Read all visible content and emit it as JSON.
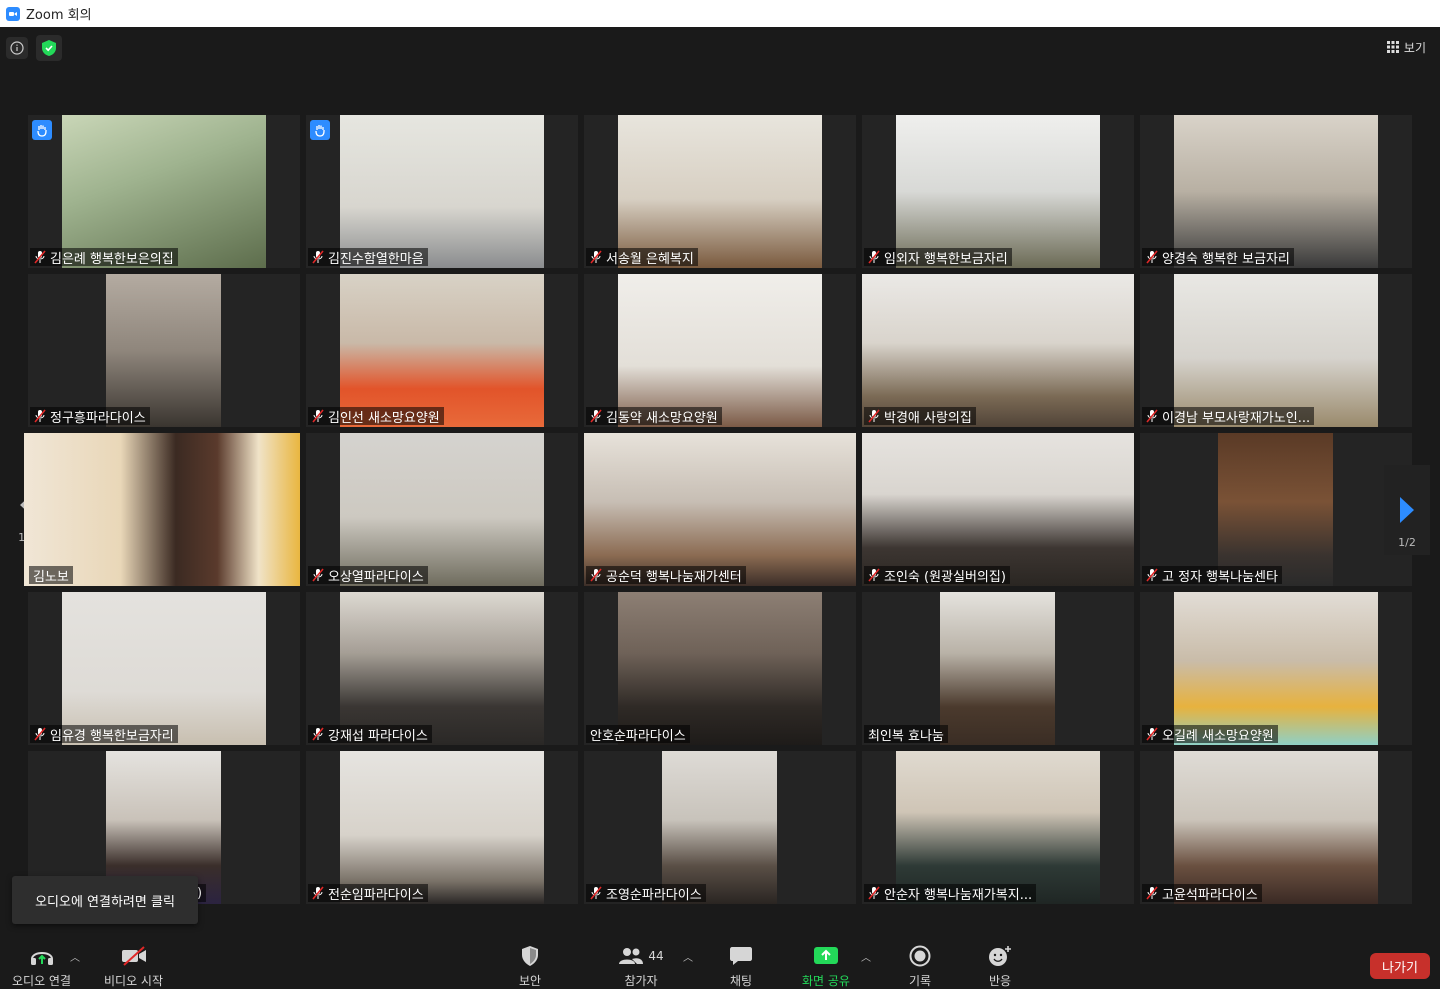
{
  "window": {
    "title": "Zoom 회의"
  },
  "topbar": {
    "view_label": "보기"
  },
  "pager": {
    "left_page": "1/2",
    "right_page": "1/2"
  },
  "tooltip": {
    "text": "오디오에 연결하려면 클릭"
  },
  "participants": [
    {
      "name": "김은례 행복한보은의집",
      "muted": true,
      "hand": true
    },
    {
      "name": "김진수함열한마음",
      "muted": true,
      "hand": true
    },
    {
      "name": "서송월 은혜복지",
      "muted": true,
      "hand": false
    },
    {
      "name": "임외자 행복한보금자리",
      "muted": true,
      "hand": false
    },
    {
      "name": "양경숙 행복한 보금자리",
      "muted": true,
      "hand": false
    },
    {
      "name": "정구흥파라다이스",
      "muted": true,
      "hand": false
    },
    {
      "name": "김인선 새소망요양원",
      "muted": true,
      "hand": false
    },
    {
      "name": "김동약 새소망요양원",
      "muted": true,
      "hand": false
    },
    {
      "name": "박경애 사랑의집",
      "muted": true,
      "hand": false
    },
    {
      "name": "이경남 부모사랑재가노인...",
      "muted": true,
      "hand": false
    },
    {
      "name": "김노보",
      "muted": false,
      "hand": false,
      "active": true
    },
    {
      "name": "오상열파라다이스",
      "muted": true,
      "hand": false
    },
    {
      "name": "공순덕 행복나눔재가센터",
      "muted": true,
      "hand": false
    },
    {
      "name": "조인숙 (원광실버의집)",
      "muted": true,
      "hand": false
    },
    {
      "name": "고 정자 행복나눔센타",
      "muted": true,
      "hand": false
    },
    {
      "name": "임유경 행복한보금자리",
      "muted": true,
      "hand": false
    },
    {
      "name": "강재섭 파라다이스",
      "muted": true,
      "hand": false
    },
    {
      "name": "안호순파라다이스",
      "muted": false,
      "hand": false
    },
    {
      "name": "최인복 효나눔",
      "muted": false,
      "hand": false
    },
    {
      "name": "오길례 새소망요양원",
      "muted": true,
      "hand": false
    },
    {
      "name": ")",
      "muted": false,
      "hand": false
    },
    {
      "name": "전순임파라다이스",
      "muted": true,
      "hand": false
    },
    {
      "name": "조영순파라다이스",
      "muted": true,
      "hand": false
    },
    {
      "name": "안순자 행복나눔재가복지...",
      "muted": true,
      "hand": false
    },
    {
      "name": "고윤석파라다이스",
      "muted": true,
      "hand": false
    }
  ],
  "toolbar": {
    "audio": "오디오 연결",
    "video": "비디오 시작",
    "security": "보안",
    "participants": "참가자",
    "participants_count": "44",
    "chat": "채팅",
    "share": "화면 공유",
    "record": "기록",
    "reactions": "반응",
    "leave": "나가기"
  },
  "colors": {
    "accent_blue": "#2d8cff",
    "share_green": "#23d959",
    "leave_red": "#c7302b",
    "active_speaker": "#c8e24a"
  }
}
